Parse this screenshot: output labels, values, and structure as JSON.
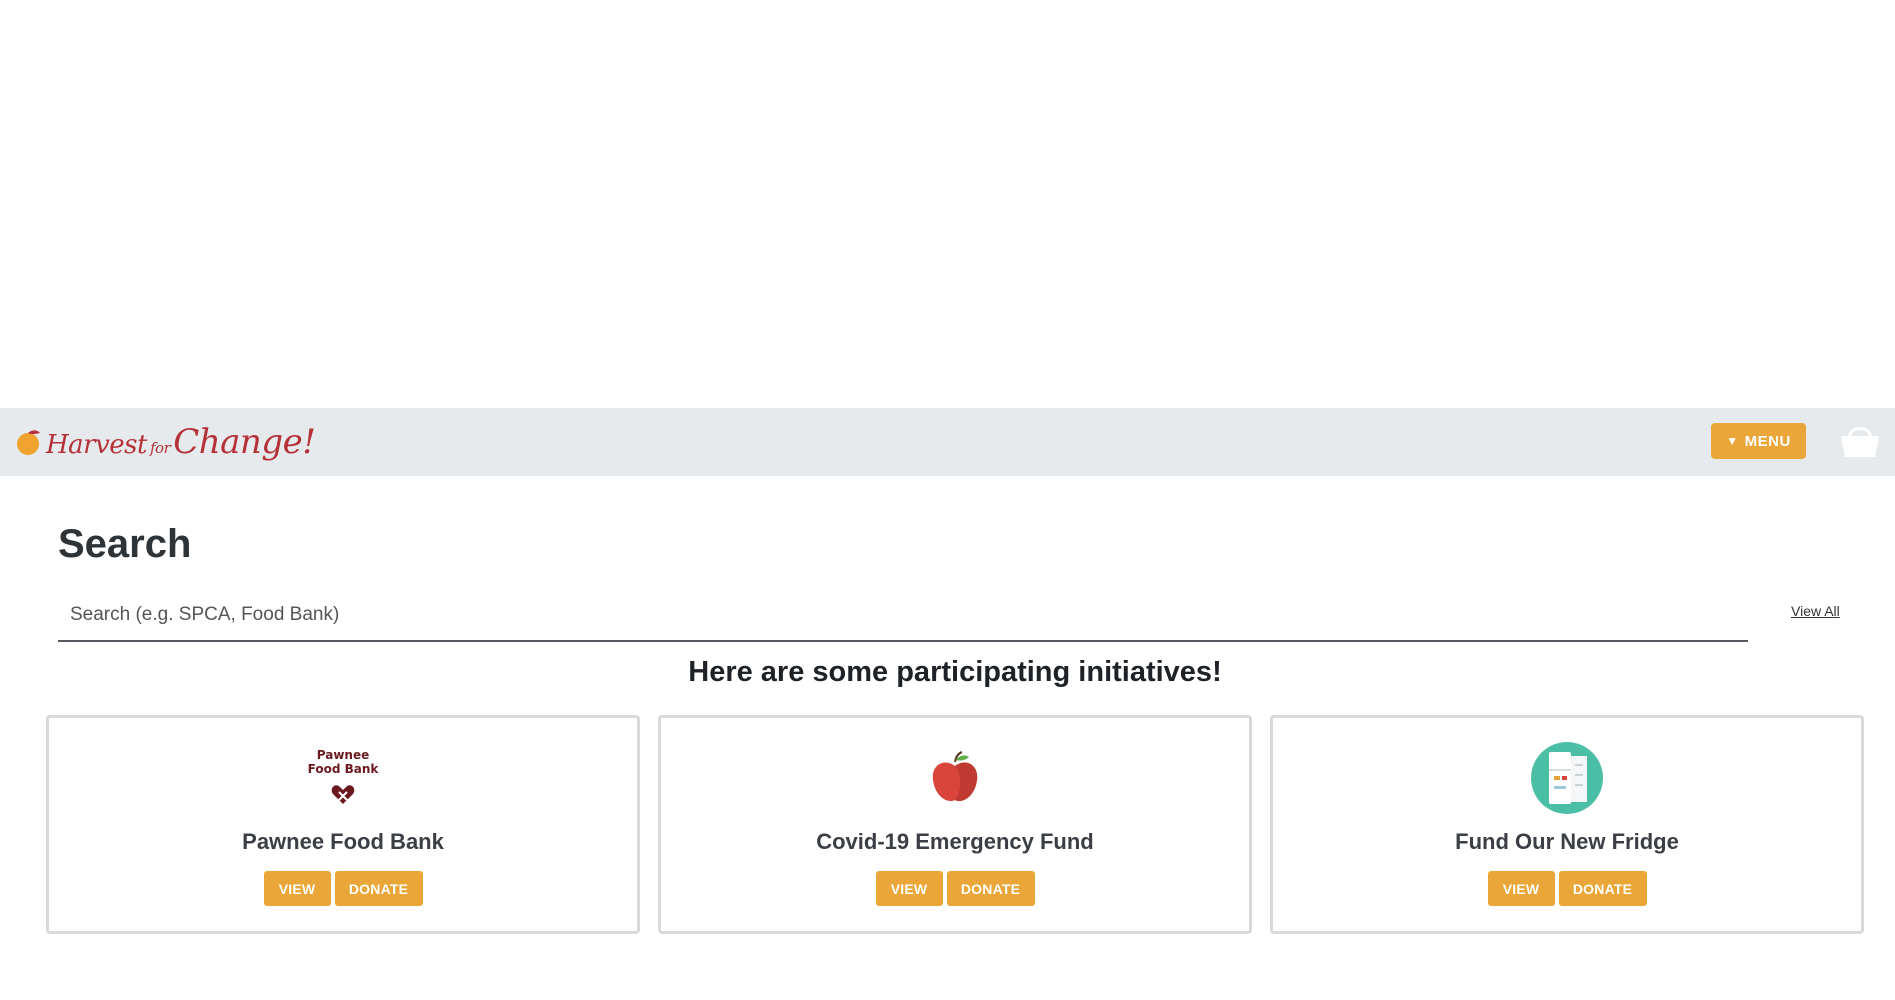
{
  "header": {
    "logo": {
      "part1": "Harvest",
      "part2": "for",
      "part3": "Change!"
    },
    "menu_label": "MENU",
    "menu_icon": "caret-down-icon",
    "basket_icon": "basket-icon"
  },
  "search": {
    "title": "Search",
    "placeholder": "Search (e.g. SPCA, Food Bank)",
    "view_all": "View All"
  },
  "initiatives": {
    "heading": "Here are some participating initiatives!",
    "cards": [
      {
        "title": "Pawnee Food Bank",
        "icon": "pawnee-food-bank-logo",
        "logo_text_1": "Pawnee",
        "logo_text_2": "Food Bank",
        "view_label": "VIEW",
        "donate_label": "DONATE"
      },
      {
        "title": "Covid-19 Emergency Fund",
        "icon": "apple-icon",
        "view_label": "VIEW",
        "donate_label": "DONATE"
      },
      {
        "title": "Fund Our New Fridge",
        "icon": "fridge-icon",
        "view_label": "VIEW",
        "donate_label": "DONATE"
      }
    ]
  },
  "colors": {
    "accent": "#eaa638",
    "navbar_bg": "#e7eaed",
    "brand_red": "#b5313a",
    "fridge_teal": "#4bbfa6",
    "apple_red": "#d9453a"
  }
}
